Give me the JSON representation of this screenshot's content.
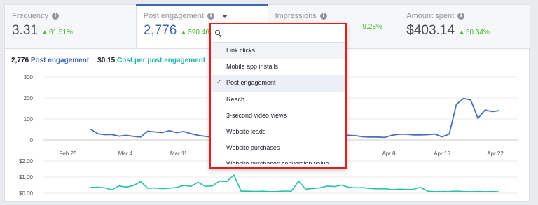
{
  "metrics": [
    {
      "label": "Frequency",
      "value": "3.31",
      "change": "61.51%"
    },
    {
      "label": "Post engagement",
      "value": "2,776",
      "change": "390.46"
    },
    {
      "label": "Impressions",
      "value": "",
      "change": "9.28%"
    },
    {
      "label": "Amount spent",
      "value": "$403.14",
      "change": "50.34%"
    }
  ],
  "legend": {
    "pe_value": "2,776",
    "pe_label": "Post engagement",
    "cpe_value": "$0.15",
    "cpe_label": "Cost per post engagement"
  },
  "dropdown": {
    "search_value": "|",
    "items": [
      {
        "label": "Link clicks",
        "state": "hover"
      },
      {
        "label": "Mobile app installs",
        "state": ""
      },
      {
        "label": "Post engagement",
        "state": "selected"
      },
      {
        "label": "Reach",
        "state": ""
      },
      {
        "label": "3-second video views",
        "state": ""
      },
      {
        "label": "Website leads",
        "state": ""
      },
      {
        "label": "Website purchases",
        "state": ""
      },
      {
        "label": "Website purchases conversion value",
        "state": "partial"
      }
    ]
  },
  "colors": {
    "post_engagement": "#4a6fbf",
    "cost_per_engagement": "#2bbfa4",
    "highlight_box": "#e02020",
    "positive": "#42b72a"
  },
  "chart_data": [
    {
      "type": "line",
      "series": [
        {
          "name": "Post engagement",
          "values": [
            52,
            30,
            25,
            26,
            18,
            22,
            17,
            14,
            42,
            38,
            35,
            44,
            35,
            40,
            30,
            22,
            17,
            14,
            12,
            13,
            12,
            12,
            11,
            12,
            12,
            11,
            13,
            12,
            14,
            12,
            13,
            16,
            14,
            13,
            20,
            25,
            22,
            20,
            15,
            14,
            14,
            12,
            22,
            27,
            27,
            24,
            24,
            25,
            28,
            15,
            28,
            170,
            198,
            190,
            103,
            143,
            135,
            140
          ]
        }
      ],
      "x_ticks": [
        "Feb 25",
        "Mar 4",
        "Mar 11",
        "Apr 8",
        "Apr 15",
        "Apr 22"
      ],
      "ylim": [
        0,
        300
      ],
      "y_ticks": [
        "300",
        "200",
        "100",
        "0"
      ],
      "grid": true
    },
    {
      "type": "line",
      "series": [
        {
          "name": "Cost per post engagement",
          "values": [
            0.35,
            0.37,
            0.33,
            0.21,
            0.45,
            0.38,
            0.47,
            0.72,
            0.3,
            0.32,
            0.28,
            0.31,
            0.35,
            0.48,
            0.42,
            0.68,
            0.42,
            0.45,
            0.75,
            0.72,
            1.12,
            0.12,
            0.12,
            0.11,
            0.12,
            0.1,
            0.11,
            0.13,
            0.12,
            0.75,
            0.25,
            0.29,
            0.33,
            0.44,
            0.41,
            0.5,
            0.36,
            0.33,
            0.34,
            0.29,
            0.26,
            0.28,
            0.22,
            0.25,
            0.23,
            0.24,
            0.36,
            0.12,
            0.09,
            0.1,
            0.11,
            0.13,
            0.1,
            0.09,
            0.11,
            0.09,
            0.1,
            0.08
          ]
        }
      ],
      "ylim": [
        0,
        2
      ],
      "y_ticks": [
        "$2.00",
        "$1.00",
        "$0.00"
      ],
      "grid": true
    }
  ]
}
